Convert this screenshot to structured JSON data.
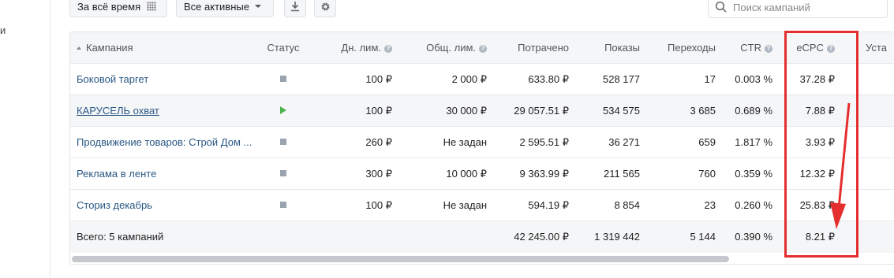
{
  "sidebar": {
    "fragment": "и"
  },
  "toolbar": {
    "period_label": "За всё время",
    "filter_label": "Все активные",
    "search_placeholder": "Поиск кампаний",
    "icons": {
      "period": "grid-icon",
      "filter": "chevron-down-icon",
      "download": "download-icon",
      "settings": "gear-icon",
      "search": "search-icon"
    }
  },
  "table": {
    "headers": {
      "name": "Кампания",
      "status": "Статус",
      "daily_limit": "Дн. лим.",
      "total_limit": "Общ. лим.",
      "spent": "Потрачено",
      "impressions": "Показы",
      "clicks": "Переходы",
      "ctr": "CTR",
      "ecpc": "eCPC",
      "next": "Уста"
    },
    "rows": [
      {
        "name": "Боковой таргет",
        "status": "stopped",
        "daily_limit": "100 ₽",
        "total_limit": "2 000 ₽",
        "spent": "633.80 ₽",
        "impressions": "528 177",
        "clicks": "17",
        "ctr": "0.003 %",
        "ecpc": "37.28 ₽"
      },
      {
        "name": "КАРУСЕЛЬ охват",
        "status": "running",
        "daily_limit": "100 ₽",
        "total_limit": "30 000 ₽",
        "spent": "29 057.51 ₽",
        "impressions": "534 575",
        "clicks": "3 685",
        "ctr": "0.689 %",
        "ecpc": "7.88 ₽"
      },
      {
        "name": "Продвижение товаров: Строй Дом ...",
        "status": "stopped",
        "daily_limit": "260 ₽",
        "total_limit": "Не задан",
        "spent": "2 595.51 ₽",
        "impressions": "36 271",
        "clicks": "659",
        "ctr": "1.817 %",
        "ecpc": "3.93 ₽"
      },
      {
        "name": "Реклама в ленте",
        "status": "stopped",
        "daily_limit": "300 ₽",
        "total_limit": "10 000 ₽",
        "spent": "9 363.99 ₽",
        "impressions": "211 565",
        "clicks": "760",
        "ctr": "0.359 %",
        "ecpc": "12.32 ₽"
      },
      {
        "name": "Сториз декабрь",
        "status": "stopped",
        "daily_limit": "100 ₽",
        "total_limit": "Не задан",
        "spent": "594.19 ₽",
        "impressions": "8 854",
        "clicks": "23",
        "ctr": "0.260 %",
        "ecpc": "25.83 ₽"
      }
    ],
    "total": {
      "label": "Всего: 5 кампаний",
      "spent": "42 245.00 ₽",
      "impressions": "1 319 442",
      "clicks": "5 144",
      "ctr": "0.390 %",
      "ecpc": "8.21 ₽"
    }
  },
  "colors": {
    "accent_link": "#2a5885",
    "annotation": "#e52e2e",
    "status_running": "#4bb34b",
    "status_stopped": "#9aa4af"
  }
}
